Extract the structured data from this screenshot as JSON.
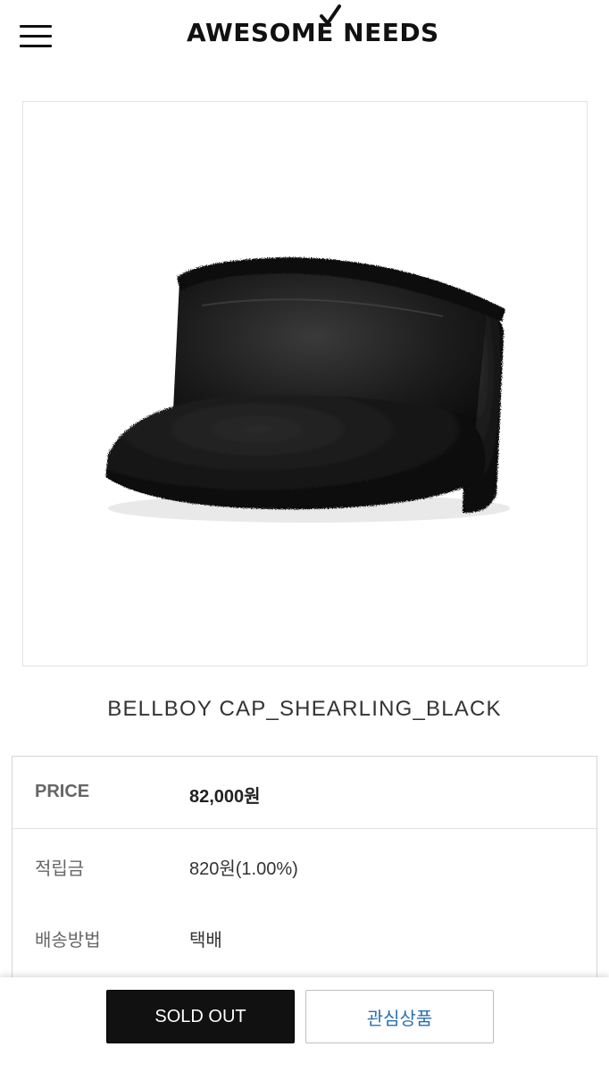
{
  "header": {
    "menu_icon": "hamburger-menu-icon",
    "logo_text": "AWESOME NEEDS"
  },
  "product": {
    "image_alt": "black shearling bellboy cap",
    "name": "BELLBOY CAP_SHEARLING_BLACK"
  },
  "info": {
    "rows": [
      {
        "label": "PRICE",
        "value": "82,000원"
      },
      {
        "label": "적립금",
        "value": "820원(1.00%)"
      },
      {
        "label": "배송방법",
        "value": "택배"
      }
    ]
  },
  "actions": {
    "soldout_label": "SOLD OUT",
    "wishlist_label": "관심상품"
  },
  "colors": {
    "primary_button_bg": "#111111",
    "wishlist_text": "#2a6fb3"
  }
}
